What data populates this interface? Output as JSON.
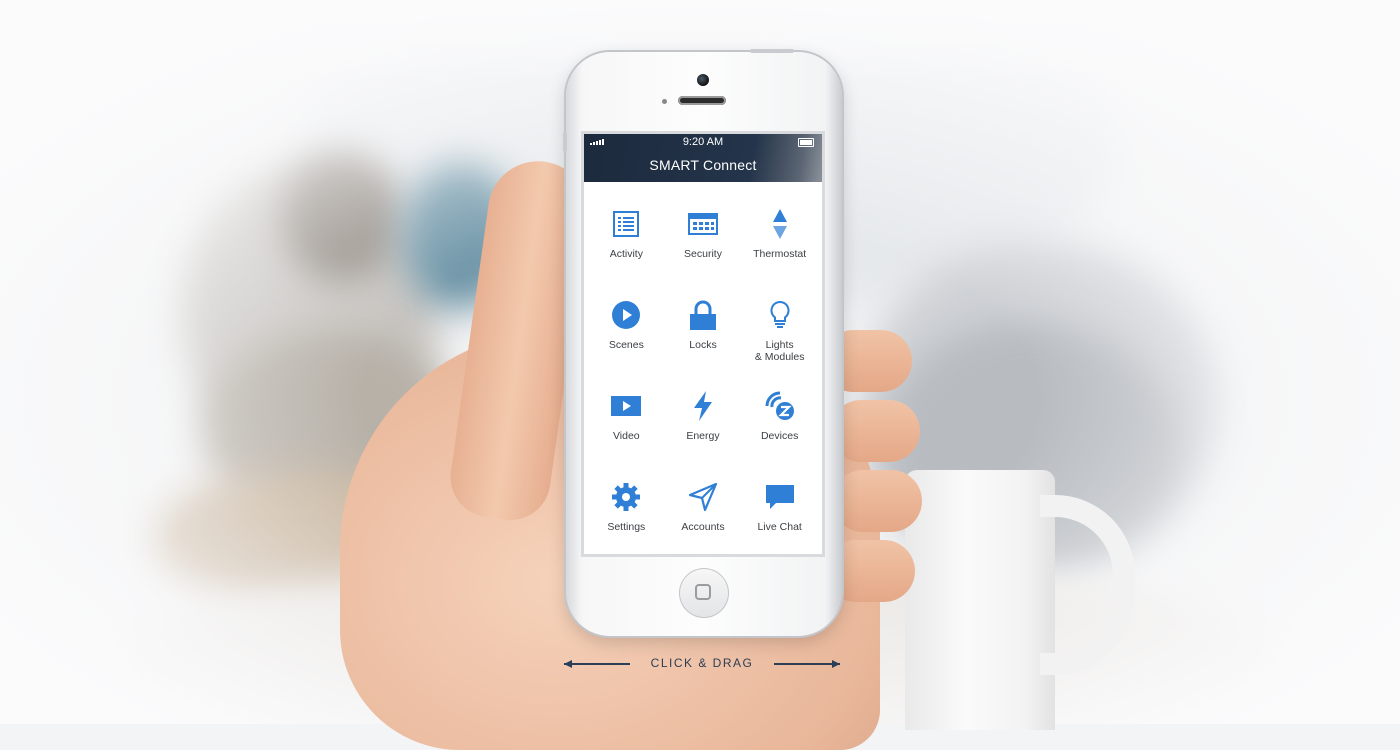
{
  "status_bar": {
    "time": "9:20 AM"
  },
  "app": {
    "title": "SMART Connect"
  },
  "menu": {
    "items": [
      {
        "label": "Activity",
        "icon": "list-icon"
      },
      {
        "label": "Security",
        "icon": "keypad-icon"
      },
      {
        "label": "Thermostat",
        "icon": "thermostat-arrows-icon"
      },
      {
        "label": "Scenes",
        "icon": "play-circle-icon"
      },
      {
        "label": "Locks",
        "icon": "lock-icon"
      },
      {
        "label": "Lights\n& Modules",
        "icon": "lightbulb-icon"
      },
      {
        "label": "Video",
        "icon": "video-icon"
      },
      {
        "label": "Energy",
        "icon": "lightning-icon"
      },
      {
        "label": "Devices",
        "icon": "zwave-icon"
      },
      {
        "label": "Settings",
        "icon": "gear-icon"
      },
      {
        "label": "Accounts",
        "icon": "navigation-arrow-icon"
      },
      {
        "label": "Live Chat",
        "icon": "chat-bubble-icon"
      }
    ]
  },
  "hint": {
    "text": "CLICK & DRAG"
  },
  "colors": {
    "accent": "#2f7fd6",
    "header": "#1f2d40",
    "hint": "#2c3e55"
  }
}
